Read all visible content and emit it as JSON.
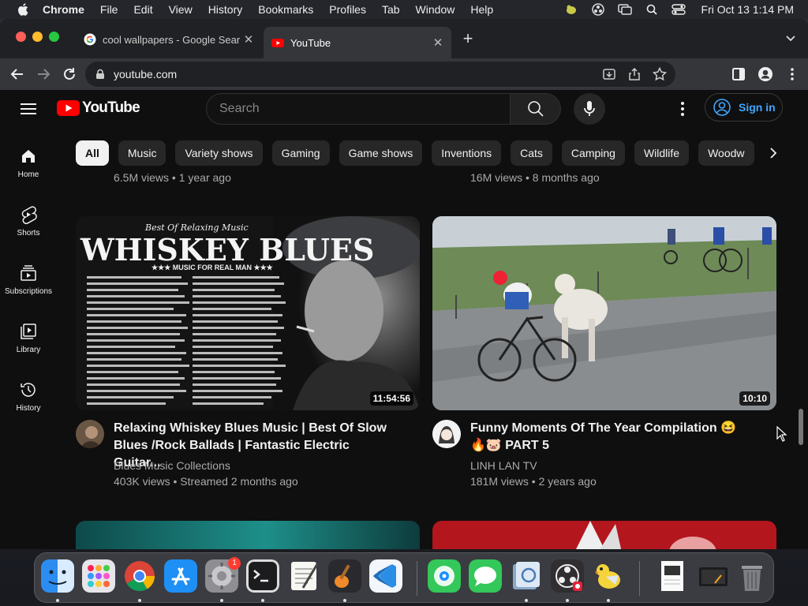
{
  "menubar": {
    "app": "Chrome",
    "items": [
      "File",
      "Edit",
      "View",
      "History",
      "Bookmarks",
      "Profiles",
      "Tab",
      "Window",
      "Help"
    ],
    "clock": "Fri Oct 13  1:14 PM"
  },
  "tabs": [
    {
      "title": "cool wallpapers - Google Sear",
      "favicon": "google-g-icon"
    },
    {
      "title": "YouTube",
      "favicon": "youtube-icon"
    }
  ],
  "omnibox": {
    "url": "youtube.com"
  },
  "youtube": {
    "logo_text": "YouTube",
    "search_placeholder": "Search",
    "signin_label": "Sign in",
    "chips": [
      "All",
      "Music",
      "Variety shows",
      "Gaming",
      "Game shows",
      "Inventions",
      "Cats",
      "Camping",
      "Wildlife",
      "Woodw"
    ],
    "rail": [
      {
        "label": "Home",
        "icon": "home-icon"
      },
      {
        "label": "Shorts",
        "icon": "shorts-icon"
      },
      {
        "label": "Subscriptions",
        "icon": "subscriptions-icon"
      },
      {
        "label": "Library",
        "icon": "library-icon"
      },
      {
        "label": "History",
        "icon": "history-icon"
      }
    ],
    "prev_row_meta": [
      "6.5M views • 1 year ago",
      "16M views • 8 months ago"
    ],
    "videos": [
      {
        "title": "Relaxing Whiskey Blues Music | Best Of Slow Blues /Rock Ballads | Fantastic Electric Guitar...",
        "channel": "Blues Music Collections",
        "stats": "403K views • Streamed 2 months ago",
        "duration": "11:54:56",
        "thumb_heading": "Best Of Relaxing Music",
        "thumb_title": "WHISKEY BLUES",
        "thumb_subtitle": "★★★ MUSIC FOR REAL MAN ★★★"
      },
      {
        "title": "Funny Moments Of The Year Compilation 😆🔥🐷 PART 5",
        "channel": "LINH LAN TV",
        "stats": "181M views • 2 years ago",
        "duration": "10:10"
      }
    ]
  },
  "dock": {
    "apps": [
      "Finder",
      "Launchpad",
      "Google Chrome",
      "App Store",
      "System Settings",
      "Terminal",
      "TextEdit",
      "GarageBand",
      "Visual Studio Code",
      "Find My",
      "Messages",
      "Preview",
      "OBS",
      "Cyberduck",
      "Screenshot",
      "Screen Recording",
      "Trash"
    ],
    "settings_badge": "1"
  },
  "colors": {
    "youtube_red": "#ff0000",
    "link_blue": "#3ea6ff",
    "bg": "#0f0f0f"
  }
}
